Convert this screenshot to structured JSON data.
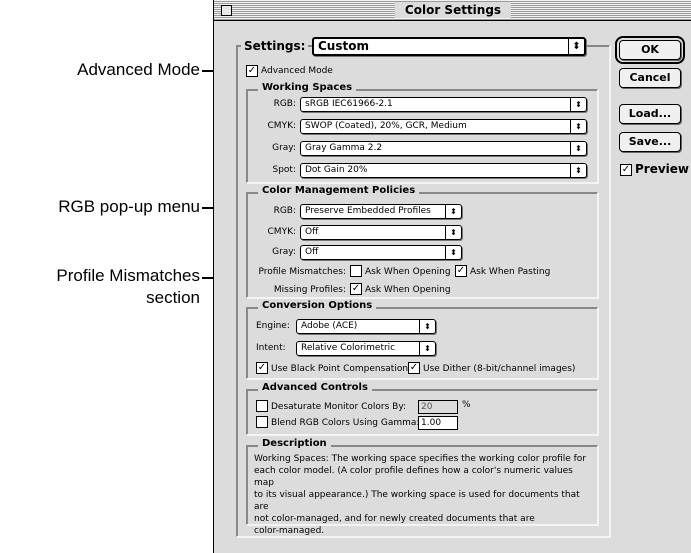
{
  "callouts": {
    "advanced_mode": "Advanced Mode",
    "rgb_popup": "RGB pop-up menu",
    "profile_mismatches_1": "Profile Mismatches",
    "profile_mismatches_2": "section"
  },
  "window": {
    "title": "Color Settings",
    "settings_label": "Settings:",
    "settings_value": "Custom",
    "advanced_mode_label": "Advanced Mode",
    "advanced_mode_checked": true
  },
  "working_spaces": {
    "title": "Working Spaces",
    "rgb_label": "RGB:",
    "rgb_value": "sRGB IEC61966-2.1",
    "cmyk_label": "CMYK:",
    "cmyk_value": "SWOP (Coated), 20%, GCR, Medium",
    "gray_label": "Gray:",
    "gray_value": "Gray Gamma 2.2",
    "spot_label": "Spot:",
    "spot_value": "Dot Gain 20%"
  },
  "policies": {
    "title": "Color Management Policies",
    "rgb_label": "RGB:",
    "rgb_value": "Preserve Embedded Profiles",
    "cmyk_label": "CMYK:",
    "cmyk_value": "Off",
    "gray_label": "Gray:",
    "gray_value": "Off",
    "mismatch_label": "Profile Mismatches:",
    "ask_opening": "Ask When Opening",
    "ask_pasting": "Ask When Pasting",
    "missing_label": "Missing Profiles:",
    "missing_ask_opening": "Ask When Opening"
  },
  "conversion": {
    "title": "Conversion Options",
    "engine_label": "Engine:",
    "engine_value": "Adobe (ACE)",
    "intent_label": "Intent:",
    "intent_value": "Relative Colorimetric",
    "bpc": "Use Black Point Compensation",
    "dither": "Use Dither (8-bit/channel images)"
  },
  "advanced": {
    "title": "Advanced Controls",
    "desaturate": "Desaturate Monitor Colors By:",
    "desaturate_value": "20",
    "percent": "%",
    "blend": "Blend RGB Colors Using Gamma:",
    "blend_value": "1.00"
  },
  "description": {
    "title": "Description",
    "lines": [
      "Working Spaces:  The working space specifies the working color profile for",
      "each color model.  (A color profile defines how a color's numeric values map",
      "to its visual appearance.)  The working space is used for documents that are",
      "not color-managed, and for newly created documents that are",
      "color-managed."
    ]
  },
  "buttons": {
    "ok": "OK",
    "cancel": "Cancel",
    "load": "Load...",
    "save": "Save...",
    "preview": "Preview"
  },
  "icons": {
    "check": "✓",
    "arrows": "⬍"
  }
}
